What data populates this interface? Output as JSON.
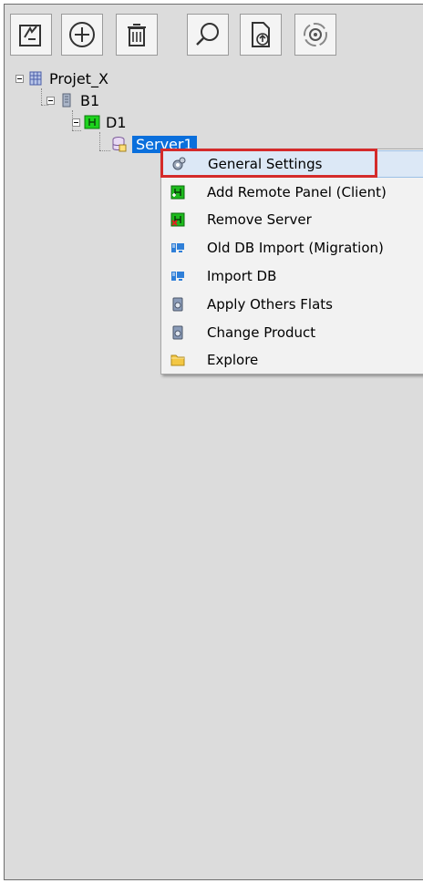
{
  "toolbar": {
    "buttons": [
      {
        "name": "edit-icon"
      },
      {
        "name": "add-icon"
      },
      {
        "name": "trash-icon"
      },
      {
        "name": "search-icon"
      },
      {
        "name": "upload-document-icon"
      },
      {
        "name": "refresh-gear-icon"
      }
    ]
  },
  "tree": {
    "project": "Projet_X",
    "building": "B1",
    "device": "D1",
    "server": "Server1"
  },
  "context_menu": {
    "items": [
      {
        "label": "General Settings",
        "icon": "gear-settings-icon",
        "highlighted": true
      },
      {
        "label": "Add Remote Panel (Client)",
        "icon": "add-panel-icon"
      },
      {
        "label": "Remove Server",
        "icon": "remove-server-icon"
      },
      {
        "label": "Old DB Import (Migration)",
        "icon": "db-import-icon"
      },
      {
        "label": "Import DB",
        "icon": "db-import-icon"
      },
      {
        "label": "Apply Others Flats",
        "icon": "apply-flats-icon"
      },
      {
        "label": "Change Product",
        "icon": "change-product-icon"
      },
      {
        "label": "Explore",
        "icon": "folder-icon"
      }
    ]
  },
  "colors": {
    "selection": "#0a6fdc",
    "highlight_box": "#d42b2b",
    "panel_bg": "#dcdcdc"
  }
}
